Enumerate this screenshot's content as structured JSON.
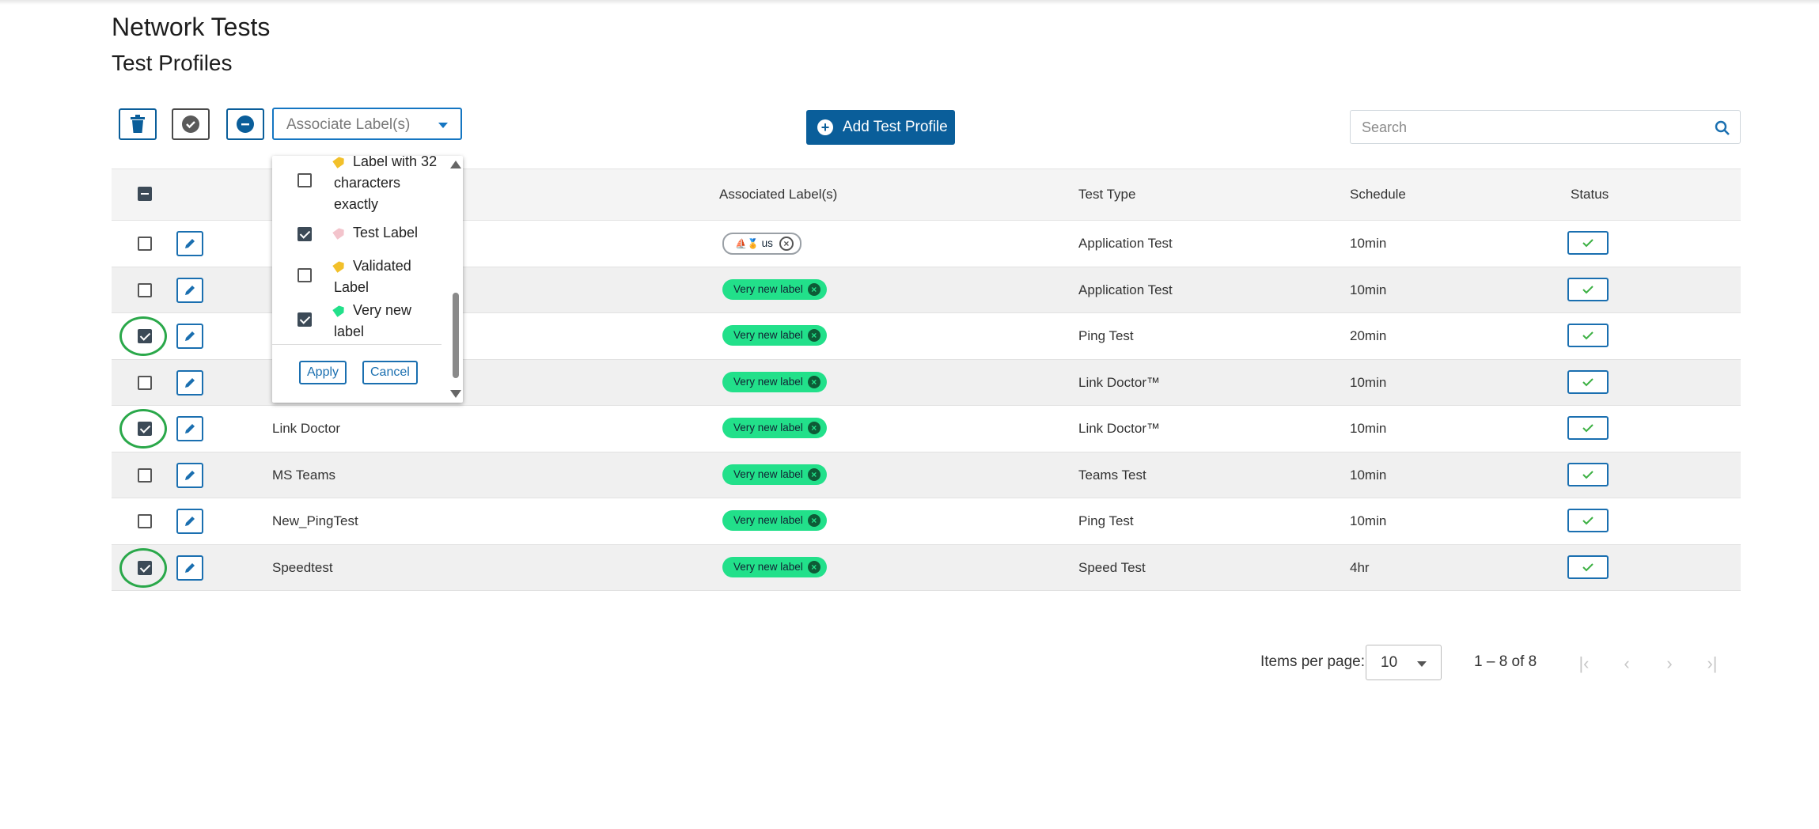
{
  "page": {
    "title": "Network Tests",
    "subtitle": "Test Profiles"
  },
  "toolbar": {
    "delete_icon": "trash-icon",
    "enable_icon": "check-circle-icon",
    "disable_icon": "minus-circle-icon",
    "associate_placeholder": "Associate Label(s)",
    "add_label": "Add Test Profile",
    "search_placeholder": "Search"
  },
  "table": {
    "headers": {
      "labels": "Associated Label(s)",
      "type": "Test Type",
      "schedule": "Schedule",
      "status": "Status"
    },
    "rows": [
      {
        "name": "",
        "label": "us",
        "label_style": "emoji",
        "type": "Application Test",
        "schedule": "10min",
        "checked": false
      },
      {
        "name": "",
        "label": "Very new label",
        "type": "Application Test",
        "schedule": "10min",
        "checked": false
      },
      {
        "name": "",
        "label": "Very new label",
        "type": "Ping Test",
        "schedule": "20min",
        "checked": true
      },
      {
        "name": "",
        "label": "Very new label",
        "type": "Link Doctor™",
        "schedule": "10min",
        "checked": false
      },
      {
        "name": "Link Doctor",
        "label": "Very new label",
        "type": "Link Doctor™",
        "schedule": "10min",
        "checked": true
      },
      {
        "name": "MS Teams",
        "label": "Very new label",
        "type": "Teams Test",
        "schedule": "10min",
        "checked": false
      },
      {
        "name": "New_PingTest",
        "label": "Very new label",
        "type": "Ping Test",
        "schedule": "10min",
        "checked": false
      },
      {
        "name": "Speedtest",
        "label": "Very new label",
        "type": "Speed Test",
        "schedule": "4hr",
        "checked": true
      }
    ]
  },
  "label_dropdown": {
    "options": [
      {
        "text": "Label with 32 characters exactly",
        "tag_color": "#f2c02a",
        "checked": false
      },
      {
        "text": "Test Label",
        "tag_color": "#f3c4cc",
        "checked": true
      },
      {
        "text": "Validated Label",
        "tag_color": "#f2c02a",
        "checked": false
      },
      {
        "text": "Very new label",
        "tag_color": "#22e08a",
        "checked": true
      }
    ],
    "apply": "Apply",
    "cancel": "Cancel"
  },
  "pagination": {
    "items_per_page_label": "Items per page:",
    "page_size": "10",
    "range": "1 – 8 of 8"
  },
  "colors": {
    "primary": "#0a5e9a",
    "label_green": "#22e08a",
    "highlight_ring": "#2aa84a"
  }
}
